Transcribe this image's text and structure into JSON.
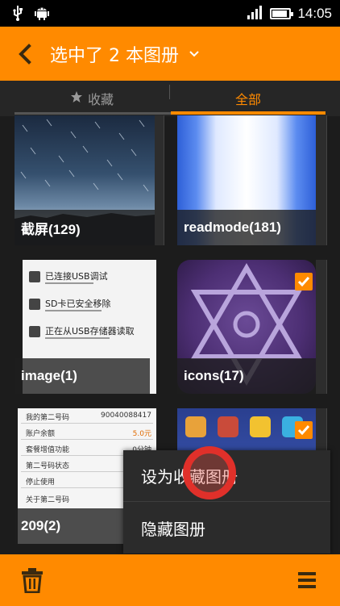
{
  "status_bar": {
    "time": "14:05",
    "icons": [
      "usb-icon",
      "android-debug-icon",
      "signal-icon",
      "battery-icon"
    ],
    "battery_level": 0.9
  },
  "action_bar": {
    "title": "选中了 2 本图册",
    "icons": [
      "back-arrow-icon",
      "chevron-down-icon"
    ]
  },
  "tabs": [
    {
      "label": "收藏",
      "icon": "star-icon",
      "selected": false
    },
    {
      "label": "全部",
      "selected": true
    }
  ],
  "albums": [
    {
      "name": "截屏(129)",
      "selected": false,
      "thumb": "starry-sky"
    },
    {
      "name": "readmode(181)",
      "selected": false,
      "thumb": "blue-glow"
    },
    {
      "name": "image(1)",
      "selected": false,
      "thumb": "settings-screenshot"
    },
    {
      "name": "icons(17)",
      "selected": true,
      "thumb": "purple-star-icon"
    },
    {
      "name": "209(2)",
      "selected": false,
      "thumb": "text-screenshot"
    },
    {
      "name": "",
      "selected": true,
      "thumb": "homescreen-icons"
    }
  ],
  "thumb_texts": {
    "image_lines": [
      "已连接USB调试",
      "SD卡已安全移除",
      "正在从USB存储器读取"
    ],
    "text_rows": [
      "我的第二号码",
      "90040088417",
      "账户余额",
      "5.0元",
      "套餐增值功能",
      "0分钟",
      "第二号码状态",
      "停止使用",
      "关于第二号码"
    ]
  },
  "popup_menu": {
    "items": [
      "设为收藏图册",
      "隐藏图册"
    ]
  },
  "bottom_bar": {
    "icons": [
      "trash-icon",
      "menu-icon"
    ]
  },
  "colors": {
    "accent": "#ff8a00",
    "background": "#1c1c1c",
    "check": "#ff8a00"
  }
}
